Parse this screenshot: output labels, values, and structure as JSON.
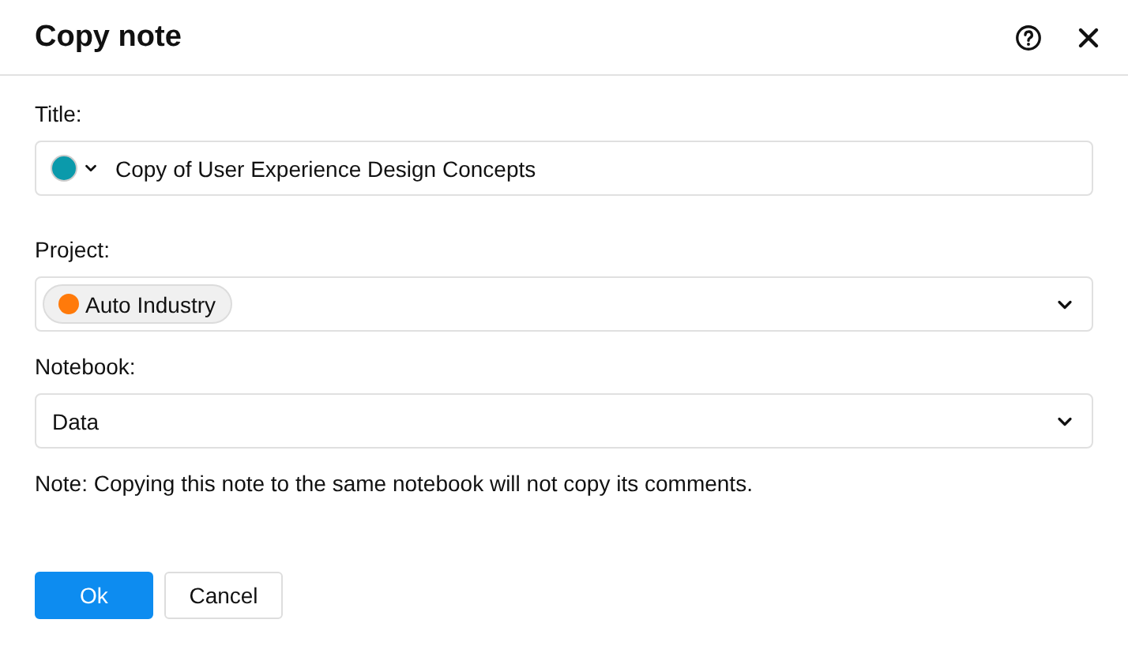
{
  "dialog": {
    "title": "Copy note"
  },
  "title_field": {
    "label": "Title:",
    "value": "Copy of User Experience Design Concepts",
    "color": "#0b9aab"
  },
  "project_field": {
    "label": "Project:",
    "tag": "Auto Industry",
    "color": "#ff7a0a"
  },
  "notebook_field": {
    "label": "Notebook:",
    "value": "Data"
  },
  "note": "Note: Copying this note to the same notebook will not copy its comments.",
  "buttons": [
    {
      "label": "Ok",
      "kind": "primary"
    },
    {
      "label": "Cancel",
      "kind": "secondary"
    }
  ]
}
